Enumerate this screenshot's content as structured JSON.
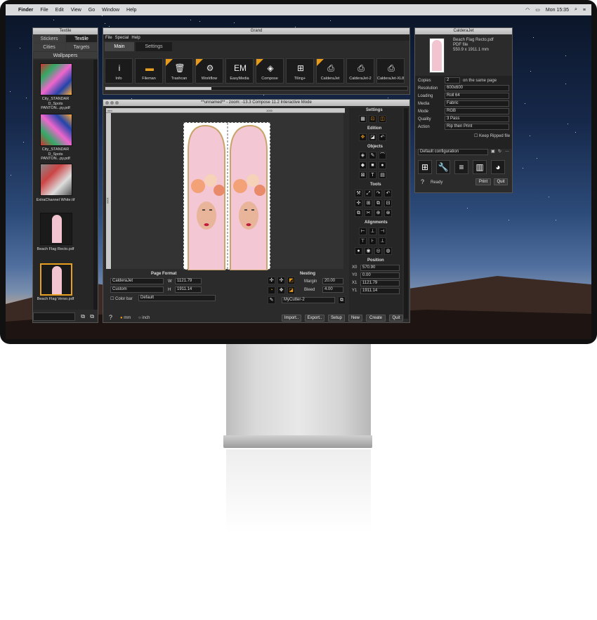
{
  "menubar": {
    "app": "Finder",
    "items": [
      "File",
      "Edit",
      "View",
      "Go",
      "Window",
      "Help"
    ],
    "clock": "Mon 15:35"
  },
  "library": {
    "title": "Textile",
    "tabs": [
      "Stickers",
      "Textile",
      "Cities",
      "Targets"
    ],
    "section": "Wallpapers",
    "items": [
      {
        "label": "City_STANDAR D_Spots PANTON...py.pdf"
      },
      {
        "label": "City_STANDAR D_Spots PANTON...py.pdf"
      },
      {
        "label": "ExtraChannel White.tif"
      },
      {
        "label": "Beach Flag Recto.pdf"
      },
      {
        "label": "Beach Flag Verso.pdf"
      }
    ]
  },
  "grand": {
    "title": "Grand",
    "menu": [
      "File",
      "Special",
      "Help"
    ],
    "tabs": [
      "Main",
      "Settings"
    ],
    "tools": [
      {
        "label": "Info",
        "icon": "info-icon"
      },
      {
        "label": "Fileman",
        "icon": "folder-icon"
      },
      {
        "label": "Trashcan",
        "icon": "trash-icon"
      },
      {
        "label": "Workflow",
        "icon": "gears-icon"
      },
      {
        "label": "EasyMedia",
        "icon": "easymedia-icon",
        "glyph": "EM"
      },
      {
        "label": "Compose",
        "icon": "compose-icon"
      },
      {
        "label": "Tiling+",
        "icon": "tiling-icon"
      },
      {
        "label": "CalderaJet",
        "icon": "printer-icon"
      },
      {
        "label": "CalderaJet-2",
        "icon": "printer-icon"
      },
      {
        "label": "CalderaJet-XL8",
        "icon": "printer-icon"
      }
    ],
    "progress": 0.35
  },
  "compose": {
    "title": "**unnamed** - zoom: -13.3 Compose 11.2 Interactive Mode",
    "ruler": {
      "unit": "mm",
      "top_tick": "1000",
      "left_tick": "1000"
    },
    "page_format": {
      "title": "Page Format",
      "printer": "CalderaJet",
      "size": "Custom",
      "w_label": "W",
      "w": "1121.79",
      "h_label": "H",
      "h": "1911.14",
      "colorbar": "Color bar",
      "colorbar_value": "Default"
    },
    "nesting": {
      "title": "Nesting",
      "margin_label": "Margin",
      "margin": "20.00",
      "bleed_label": "Bleed",
      "bleed": "4.00",
      "cutter": "MyCutter-2"
    },
    "units": [
      "mm",
      "inch"
    ],
    "buttons": [
      "Import..",
      "Export..",
      "Setup",
      "New",
      "Create",
      "Quit"
    ],
    "help": "?",
    "side": {
      "settings": "Settings",
      "edition": "Edition",
      "objects": "Objects",
      "tools": "Tools",
      "alignments": "Alignments",
      "position": "Position",
      "pos": [
        {
          "k": "X0",
          "v": "570.90"
        },
        {
          "k": "Y0",
          "v": "0.00"
        },
        {
          "k": "X1",
          "v": "1121.79"
        },
        {
          "k": "Y1",
          "v": "1911.14"
        }
      ]
    }
  },
  "caldera": {
    "title": "CalderaJet",
    "file": "Beach Flag Recto.pdf",
    "type": "PDF file",
    "dims": "550.9 x 1911.1 mm",
    "rows": [
      {
        "k": "Copies",
        "v": "2"
      },
      {
        "k": "Resolution",
        "v": "600x600"
      },
      {
        "k": "Loading",
        "v": "Roll 64"
      },
      {
        "k": "Media",
        "v": "Fabric"
      },
      {
        "k": "Mode",
        "v": "RGB"
      },
      {
        "k": "Quality",
        "v": "3 Pass"
      },
      {
        "k": "Action",
        "v": "Rip then Print"
      }
    ],
    "copies_note": "on the same page",
    "keep": "Keep Ripped file",
    "config": "Default configuration",
    "status": "Ready",
    "print": "Print",
    "quit": "Quit",
    "help": "?"
  }
}
